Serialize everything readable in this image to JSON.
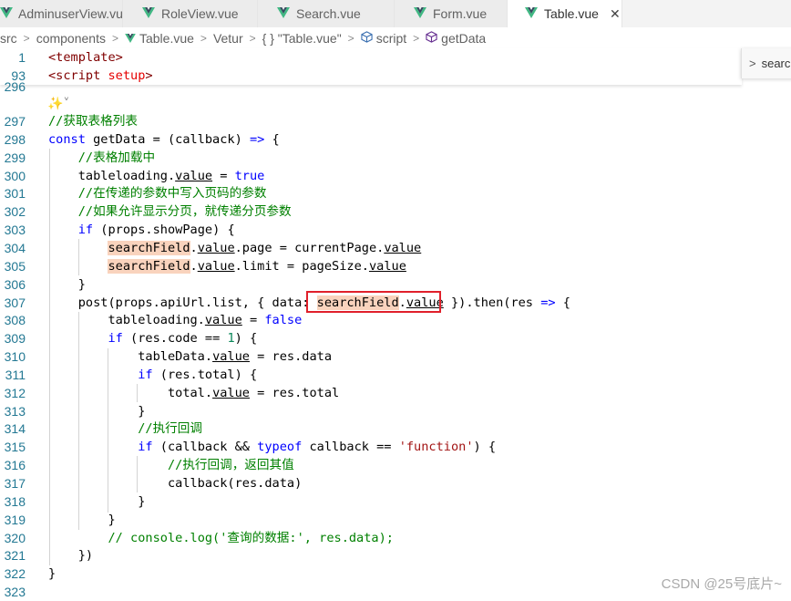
{
  "tabs": [
    {
      "label": "AdminuserView.vue"
    },
    {
      "label": "RoleView.vue"
    },
    {
      "label": "Search.vue"
    },
    {
      "label": "Form.vue"
    },
    {
      "label": "Table.vue",
      "active": true
    }
  ],
  "close_glyph": "✕",
  "vue_icon_color": "#41b883",
  "breadcrumb": {
    "items": [
      "src",
      "components",
      "Table.vue",
      "Vetur",
      "{ } \"Table.vue\"",
      "script",
      "getData"
    ]
  },
  "search_widget": {
    "text": "searc"
  },
  "sticky_lines": [
    {
      "num": "1",
      "html": "<span class=\"c-tag\">&lt;template&gt;</span>"
    },
    {
      "num": "93",
      "html": "<span class=\"c-tag\">&lt;script</span> <span style=\"color:#e50000\">setup</span><span class=\"c-tag\">&gt;</span>"
    }
  ],
  "partial_line": "296",
  "lines": [
    {
      "num": "297",
      "html": "<span class=\"c-comment\">//获取表格列表</span>"
    },
    {
      "num": "298",
      "html": "<span class=\"c-kw\">const</span> getData = (callback) <span class=\"c-kw\">=&gt;</span> {"
    },
    {
      "num": "299",
      "html": "    <span class=\"c-comment\">//表格加载中</span>"
    },
    {
      "num": "300",
      "html": "    tableloading.<span class=\"u\">value</span> = <span class=\"c-kw\">true</span>"
    },
    {
      "num": "301",
      "html": "    <span class=\"c-comment\">//在传递的参数中写入页码的参数</span>"
    },
    {
      "num": "302",
      "html": "    <span class=\"c-comment\">//如果允许显示分页，就传递分页参数</span>"
    },
    {
      "num": "303",
      "html": "    <span class=\"c-kw\">if</span> (props.showPage) {"
    },
    {
      "num": "304",
      "html": "        <span class=\"hl-orange\">searchField</span>.<span class=\"u\">value</span>.page = currentPage.<span class=\"u\">value</span>"
    },
    {
      "num": "305",
      "html": "        <span class=\"hl-orange\">searchField</span>.<span class=\"u\">value</span>.limit = pageSize.<span class=\"u\">value</span>"
    },
    {
      "num": "306",
      "html": "    }"
    },
    {
      "num": "307",
      "html": "    post(props.apiUrl.list, { data: <span class=\"hl-orange\">searchField</span>.<span class=\"u\">value</span> }).then(res <span class=\"c-kw\">=&gt;</span> {"
    },
    {
      "num": "308",
      "html": "        tableloading.<span class=\"u\">value</span> = <span class=\"c-kw\">false</span>"
    },
    {
      "num": "309",
      "html": "        <span class=\"c-kw\">if</span> (res.code == <span class=\"c-num\">1</span>) {"
    },
    {
      "num": "310",
      "html": "            tableData.<span class=\"u\">value</span> = res.data"
    },
    {
      "num": "311",
      "html": "            <span class=\"c-kw\">if</span> (res.total) {"
    },
    {
      "num": "312",
      "html": "                total.<span class=\"u\">value</span> = res.total"
    },
    {
      "num": "313",
      "html": "            }"
    },
    {
      "num": "314",
      "html": "            <span class=\"c-comment\">//执行回调</span>"
    },
    {
      "num": "315",
      "html": "            <span class=\"c-kw\">if</span> (callback &amp;&amp; <span class=\"c-kw\">typeof</span> callback == <span class=\"c-str\">'function'</span>) {"
    },
    {
      "num": "316",
      "html": "                <span class=\"c-comment\">//执行回调，返回其值</span>"
    },
    {
      "num": "317",
      "html": "                callback(res.data)"
    },
    {
      "num": "318",
      "html": "            }"
    },
    {
      "num": "319",
      "html": "        }"
    },
    {
      "num": "320",
      "html": "        <span class=\"c-comment\">// console.log('查询的数据:', res.data);</span>"
    },
    {
      "num": "321",
      "html": "    })"
    },
    {
      "num": "322",
      "html": "}"
    },
    {
      "num": "323",
      "html": ""
    }
  ],
  "watermark": "CSDN @25号底片~"
}
